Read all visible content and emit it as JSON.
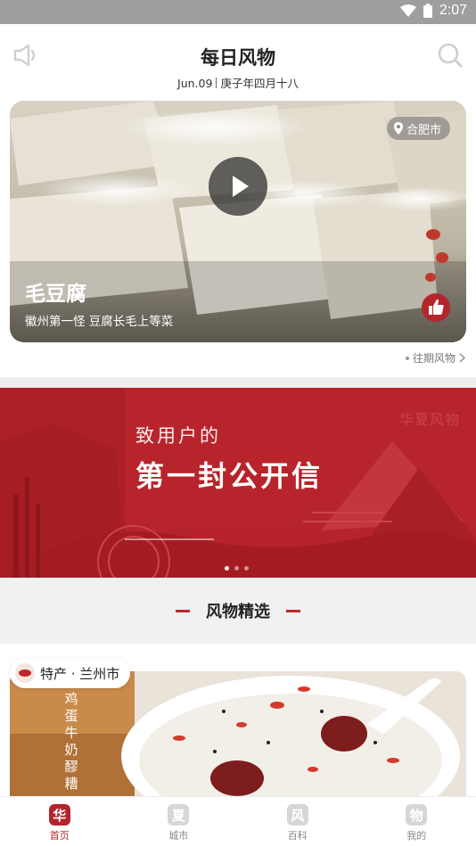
{
  "status_bar": {
    "time": "2:07"
  },
  "header": {
    "title": "每日风物",
    "date_en": "Jun.09",
    "date_cn": "庚子年四月十八"
  },
  "hero": {
    "location": "合肥市",
    "name": "毛豆腐",
    "subtitle": "徽州第一怪 豆腐长毛上等菜"
  },
  "past_link": "往期风物",
  "banner": {
    "line1": "致用户的",
    "line2": "第一封公开信",
    "brand": "华夏风物",
    "page_count": 3,
    "active_index": 0
  },
  "section": {
    "title": "风物精选"
  },
  "feed_card": {
    "tag": "特产 · 兰州市",
    "vertical_text": "鸡蛋牛奶醪糟"
  },
  "tabs": [
    {
      "label": "首页",
      "glyph": "华",
      "active": true
    },
    {
      "label": "城市",
      "glyph": "夏",
      "active": false
    },
    {
      "label": "百科",
      "glyph": "风",
      "active": false
    },
    {
      "label": "我的",
      "glyph": "物",
      "active": false
    }
  ],
  "colors": {
    "accent": "#b3262c",
    "status_bar": "#9e9e9e"
  }
}
